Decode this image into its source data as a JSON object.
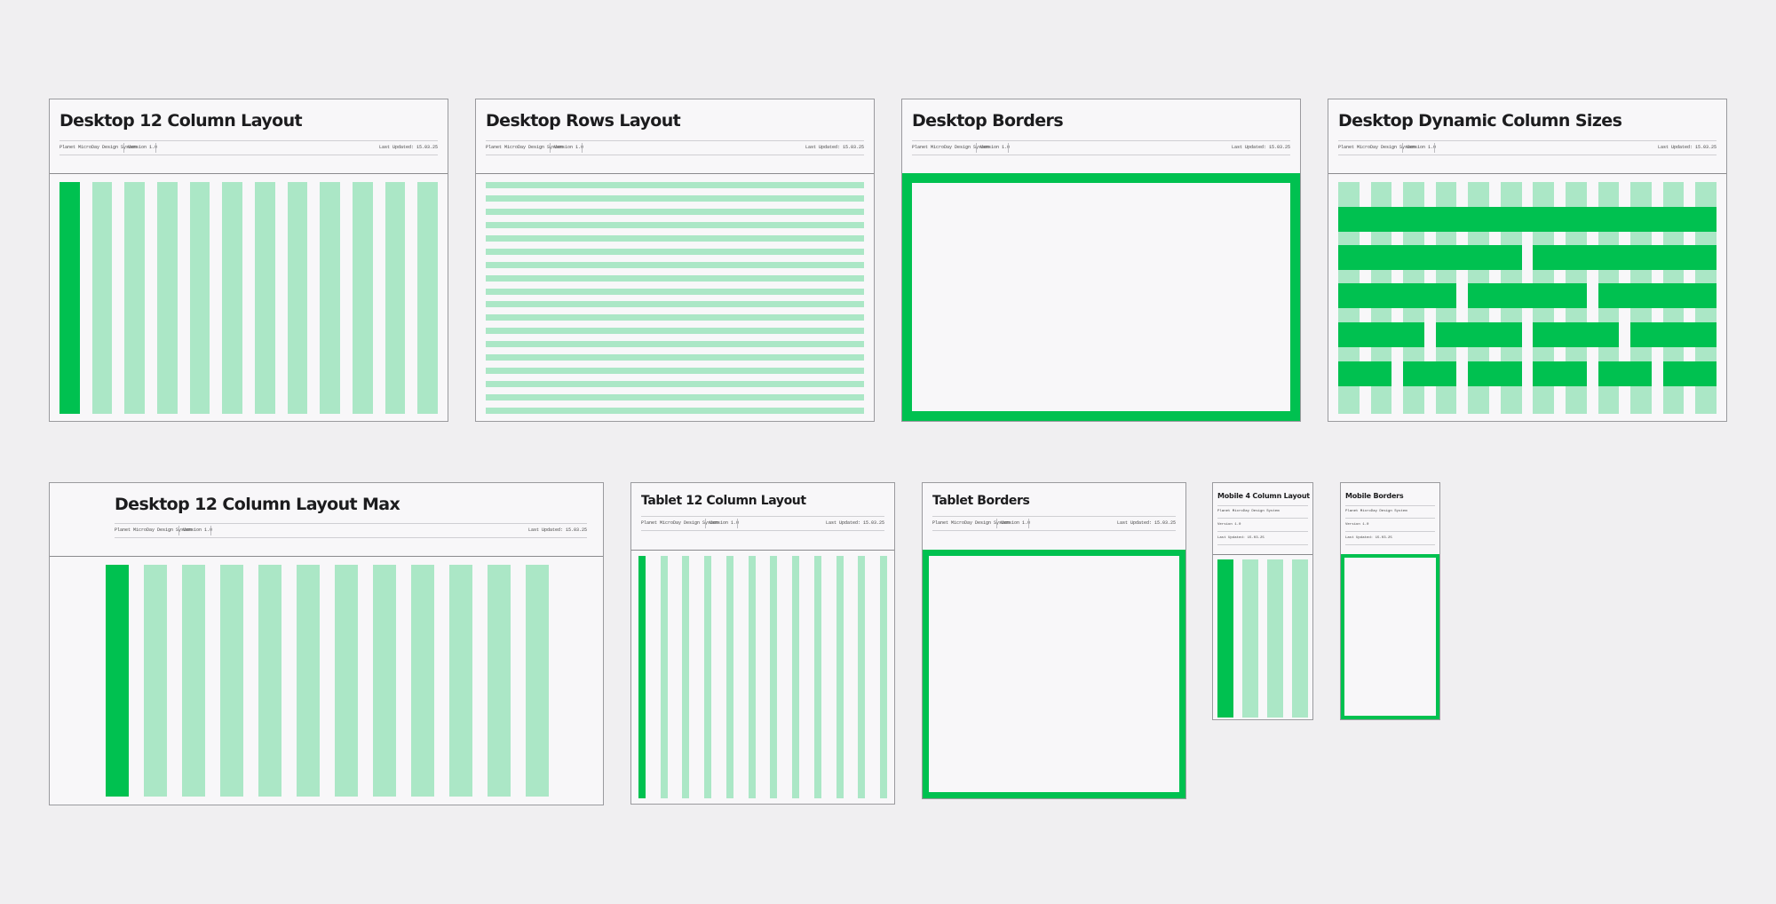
{
  "colors": {
    "background": "#f0eff1",
    "card": "#f8f7f9",
    "accent": "#00c150",
    "accent_light": "#abe7c6",
    "border": "#9a9a9e"
  },
  "meta": {
    "system": "Planet MicroDay Design System",
    "version": "Version 1.0",
    "updated": "Last Updated: 15.03.25"
  },
  "cards": {
    "d12": {
      "title": "Desktop 12 Column Layout"
    },
    "drows": {
      "title": "Desktop Rows Layout"
    },
    "dborders": {
      "title": "Desktop Borders"
    },
    "ddyn": {
      "title": "Desktop Dynamic Column  Sizes"
    },
    "dmax": {
      "title": "Desktop 12 Column Layout Max"
    },
    "t12": {
      "title": "Tablet 12 Column Layout"
    },
    "tborders": {
      "title": "Tablet Borders"
    },
    "m4": {
      "title": "Mobile 4 Column Layout"
    },
    "mborders": {
      "title": "Mobile Borders"
    }
  }
}
